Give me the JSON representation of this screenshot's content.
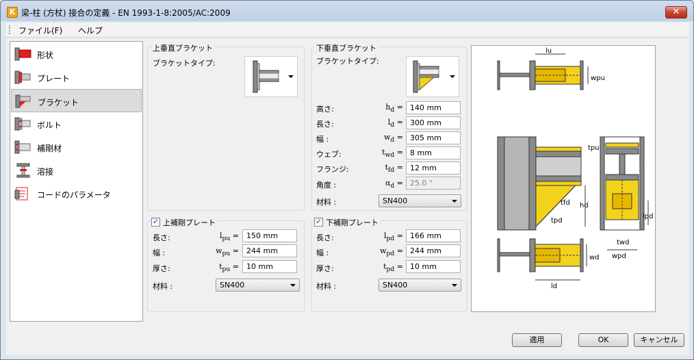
{
  "window": {
    "title": "梁-柱 (方杖) 接合の定義 - EN 1993-1-8:2005/AC:2009",
    "close": "✕"
  },
  "menu": {
    "file": "ファイル(F)",
    "help": "ヘルプ"
  },
  "sidebar": {
    "items": [
      {
        "label": "形状",
        "icon": "shape-icon"
      },
      {
        "label": "プレート",
        "icon": "plate-icon"
      },
      {
        "label": "ブラケット",
        "icon": "bracket-icon",
        "selected": true
      },
      {
        "label": "ボルト",
        "icon": "bolt-icon"
      },
      {
        "label": "補剛材",
        "icon": "stiffener-icon"
      },
      {
        "label": "溶接",
        "icon": "weld-icon"
      },
      {
        "label": "コードのパラメータ",
        "icon": "code-params-icon"
      }
    ]
  },
  "upper_bracket": {
    "title": "上垂直ブラケット",
    "type_label": "ブラケットタイプ:"
  },
  "lower_bracket": {
    "title": "下垂直ブラケット",
    "type_label": "ブラケットタイプ:",
    "rows": [
      {
        "label": "高さ:",
        "sym": "h",
        "sub": "d",
        "value": "140 mm"
      },
      {
        "label": "長さ:",
        "sym": "l",
        "sub": "d",
        "value": "300 mm"
      },
      {
        "label": "幅 :",
        "sym": "w",
        "sub": "d",
        "value": "305 mm"
      },
      {
        "label": "ウェブ:",
        "sym": "t",
        "sub": "wd",
        "value": "8 mm"
      },
      {
        "label": "フランジ:",
        "sym": "t",
        "sub": "fd",
        "value": "12 mm"
      },
      {
        "label": "角度 :",
        "sym": "α",
        "sub": "d",
        "value": "25.0 °",
        "disabled": true
      }
    ],
    "material_label": "材料 :",
    "material": "SN400"
  },
  "upper_stiffener": {
    "title": "上補剛プレート",
    "checked": true,
    "rows": [
      {
        "label": "長さ:",
        "sym": "l",
        "sub": "pu",
        "value": "150 mm"
      },
      {
        "label": "幅 :",
        "sym": "w",
        "sub": "pu",
        "value": "244 mm"
      },
      {
        "label": "厚さ:",
        "sym": "t",
        "sub": "pu",
        "value": "10 mm"
      }
    ],
    "material_label": "材料 :",
    "material": "SN400"
  },
  "lower_stiffener": {
    "title": "下補剛プレート",
    "checked": true,
    "rows": [
      {
        "label": "長さ:",
        "sym": "l",
        "sub": "pd",
        "value": "166 mm"
      },
      {
        "label": "幅 :",
        "sym": "w",
        "sub": "pd",
        "value": "244 mm"
      },
      {
        "label": "厚さ:",
        "sym": "t",
        "sub": "pd",
        "value": "10 mm"
      }
    ],
    "material_label": "材料 :",
    "material": "SN400"
  },
  "diagram_labels": {
    "lu": "lu",
    "wpu": "wpu",
    "tpu": "tpu",
    "tfd": "tfd",
    "hd": "hd",
    "tpd": "tpd",
    "lpd": "lpd",
    "twd": "twd",
    "wpd": "wpd",
    "wd": "wd",
    "ld": "ld"
  },
  "buttons": {
    "apply": "適用",
    "ok": "OK",
    "cancel": "キャンセル"
  },
  "colors": {
    "steel": "#8a8a8a",
    "plate": "#f2d21d",
    "accent_red": "#e02020"
  }
}
